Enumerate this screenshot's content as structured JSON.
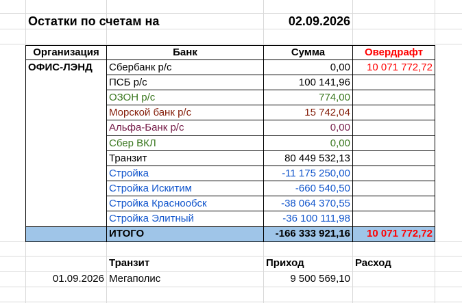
{
  "colors": {
    "black": "#000000",
    "green": "#38761d",
    "maroon": "#85200c",
    "purple": "#741b47",
    "blue": "#1155cc",
    "red": "#ff0000",
    "total_fill": "#9fc5e8"
  },
  "title": {
    "label": "Остатки по счетам на",
    "date": "02.09.2026"
  },
  "headers": {
    "org": "Организация",
    "bank": "Банк",
    "sum": "Сумма",
    "overdraft": "Овердрафт"
  },
  "org_name": "ОФИС-ЛЭНД",
  "rows": [
    {
      "bank": "Сбербанк р/с",
      "sum": "0,00",
      "overdraft": "10 071 772,72",
      "color": "black"
    },
    {
      "bank": "ПСБ р/с",
      "sum": "100 141,96",
      "overdraft": "",
      "color": "black"
    },
    {
      "bank": "ОЗОН р/с",
      "sum": "774,00",
      "overdraft": "",
      "color": "green"
    },
    {
      "bank": "Морской банк р/с",
      "sum": "15 742,04",
      "overdraft": "",
      "color": "maroon"
    },
    {
      "bank": "Альфа-Банк р/с",
      "sum": "0,00",
      "overdraft": "",
      "color": "purple"
    },
    {
      "bank": "Сбер ВКЛ",
      "sum": "0,00",
      "overdraft": "",
      "color": "green"
    },
    {
      "bank": "Транзит",
      "sum": "80 449 532,13",
      "overdraft": "",
      "color": "black"
    },
    {
      "bank": "Стройка",
      "sum": "-11 175 250,00",
      "overdraft": "",
      "color": "blue"
    },
    {
      "bank": "Стройка Искитим",
      "sum": "-660 540,50",
      "overdraft": "",
      "color": "blue"
    },
    {
      "bank": "Стройка Краснообск",
      "sum": "-38 064 370,55",
      "overdraft": "",
      "color": "blue"
    },
    {
      "bank": "Стройка Элитный",
      "sum": "-36 100 111,98",
      "overdraft": "",
      "color": "blue"
    }
  ],
  "total": {
    "label": "ИТОГО",
    "sum": "-166 333 921,16",
    "overdraft": "10 071 772,72"
  },
  "transit": {
    "headers": {
      "name": "Транзит",
      "income": "Приход",
      "expense": "Расход"
    },
    "rows": [
      {
        "date": "01.09.2026",
        "name": "Мегаполис",
        "income": "9 500 569,10",
        "expense": ""
      }
    ]
  }
}
